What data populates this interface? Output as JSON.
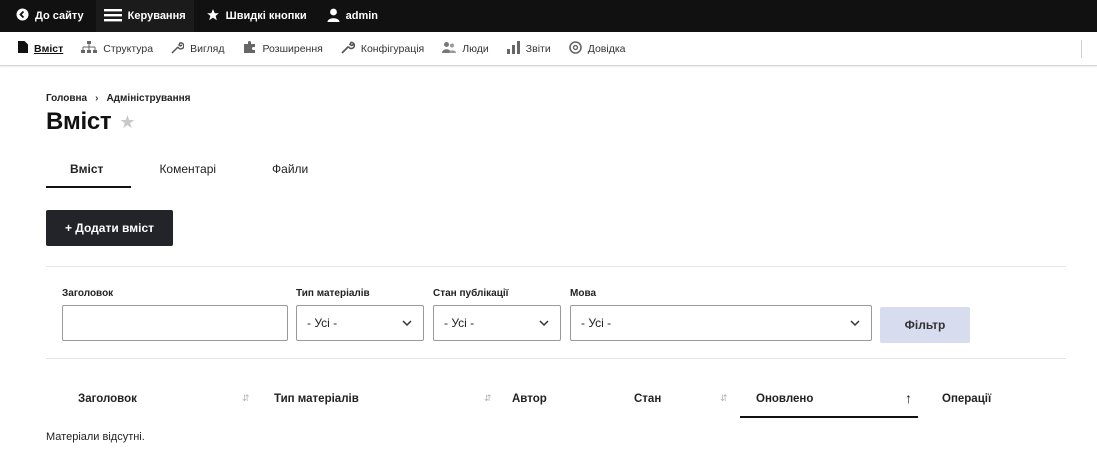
{
  "toolbar": {
    "back_label": "До сайту",
    "manage_label": "Керування",
    "shortcuts_label": "Швидкі кнопки",
    "user_label": "admin"
  },
  "tray": {
    "items": [
      {
        "label": "Вміст",
        "icon": "file-icon"
      },
      {
        "label": "Структура",
        "icon": "structure-icon"
      },
      {
        "label": "Вигляд",
        "icon": "wrench-icon"
      },
      {
        "label": "Розширення",
        "icon": "puzzle-icon"
      },
      {
        "label": "Конфігурація",
        "icon": "wrench-icon"
      },
      {
        "label": "Люди",
        "icon": "people-icon"
      },
      {
        "label": "Звіти",
        "icon": "chart-icon"
      },
      {
        "label": "Довідка",
        "icon": "help-icon"
      }
    ]
  },
  "breadcrumb": {
    "home": "Головна",
    "separator": "›",
    "admin": "Адміністрування"
  },
  "page": {
    "title": "Вміст"
  },
  "tabs": [
    {
      "label": "Вміст"
    },
    {
      "label": "Коментарі"
    },
    {
      "label": "Файли"
    }
  ],
  "add_button": "+ Додати вміст",
  "filters": {
    "title_label": "Заголовок",
    "title_value": "",
    "type_label": "Тип матеріалів",
    "type_value": "- Усі -",
    "status_label": "Стан публікації",
    "status_value": "- Усі -",
    "lang_label": "Мова",
    "lang_value": "- Усі -",
    "submit": "Фільтр"
  },
  "table": {
    "columns": [
      "Заголовок",
      "Тип матеріалів",
      "Автор",
      "Стан",
      "Оновлено",
      "Операції"
    ],
    "sorted_column": "Оновлено",
    "sort_direction": "↑",
    "empty": "Матеріали відсутні."
  },
  "colors": {
    "toolbar_bg": "#111111",
    "button_dark": "#232429",
    "filter_button": "#d7dcef"
  }
}
